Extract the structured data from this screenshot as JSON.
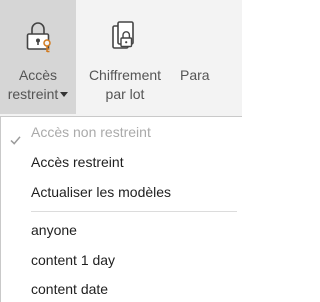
{
  "ribbon": {
    "access_button": {
      "line1": "Accès",
      "line2": "restreint",
      "icon": "lock-user-icon"
    },
    "batch_encrypt_button": {
      "line1": "Chiffrement",
      "line2": "par lot",
      "icon": "copy-lock-icon"
    },
    "partial_button": {
      "line1": "Para"
    }
  },
  "menu": {
    "items": [
      {
        "label": "Accès non restreint",
        "checked": true,
        "disabled": true
      },
      {
        "label": "Accès restreint"
      },
      {
        "label": "Actualiser les modèles"
      }
    ],
    "templates": [
      {
        "label": "anyone"
      },
      {
        "label": "content 1 day"
      },
      {
        "label": "content date"
      }
    ]
  }
}
